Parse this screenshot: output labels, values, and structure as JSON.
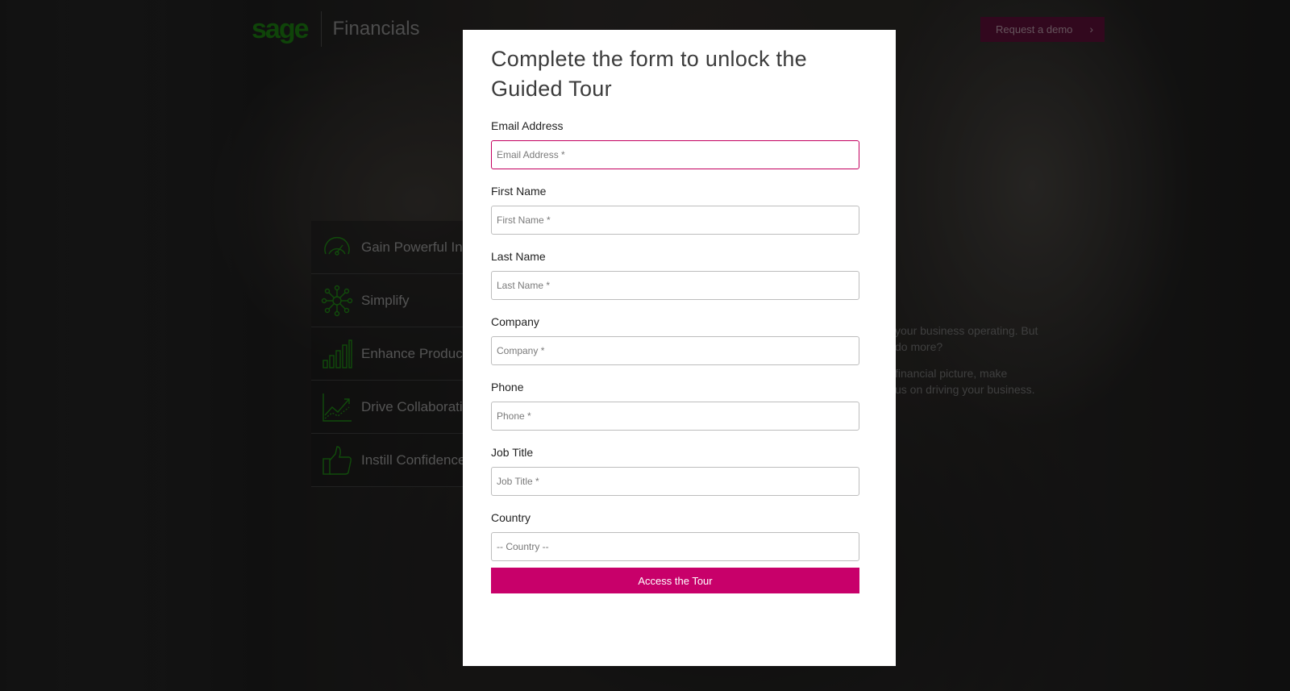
{
  "brand": {
    "logo": "sage",
    "product": "Financials",
    "logo_color": "#1c7d12"
  },
  "header": {
    "demo_button": "Request a demo",
    "demo_icon": "chevron-right-icon"
  },
  "features": [
    {
      "label": "Gain Powerful Ins",
      "icon": "speedometer-icon"
    },
    {
      "label": "Simplify",
      "icon": "network-icon"
    },
    {
      "label": "Enhance Product",
      "icon": "bar-chart-icon"
    },
    {
      "label": "Drive Collaboratio",
      "icon": "trend-line-icon"
    },
    {
      "label": "Instill Confidence",
      "icon": "thumbs-up-icon"
    }
  ],
  "background_text": {
    "line1": "your business operating. But",
    "line2": "do more?",
    "line3": "financial picture, make",
    "line4": "us on driving your business."
  },
  "modal": {
    "title": "Complete the form to unlock the Guided Tour",
    "fields": [
      {
        "label": "Email Address",
        "placeholder": "Email Address *"
      },
      {
        "label": "First Name",
        "placeholder": "First Name *"
      },
      {
        "label": "Last Name",
        "placeholder": "Last Name *"
      },
      {
        "label": "Company",
        "placeholder": "Company *"
      },
      {
        "label": "Phone",
        "placeholder": "Phone *"
      },
      {
        "label": "Job Title",
        "placeholder": "Job Title *"
      },
      {
        "label": "Country",
        "selected": "-- Country --"
      }
    ],
    "submit": "Access the Tour",
    "accent_color": "#c8006a"
  }
}
